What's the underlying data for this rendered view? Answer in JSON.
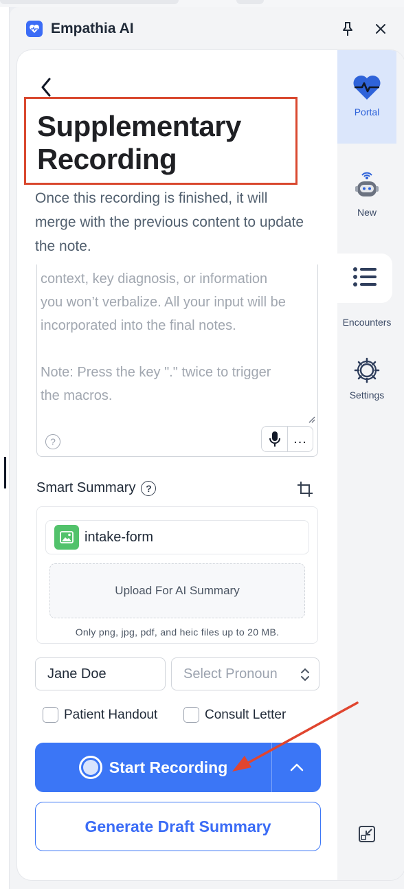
{
  "app": {
    "title": "Empathia AI"
  },
  "page": {
    "title_line1": "Supplementary",
    "title_line2": "Recording",
    "subtitle": "Once this recording is finished, it will merge with the previous content to update the note."
  },
  "notes": {
    "text": "context, key diagnosis, or information\nyou won’t verbalize. All your input will be\nincorporated into the final notes.\n\nNote: Press the key \".\" twice to trigger\nthe macros.",
    "more_label": "..."
  },
  "smart_summary": {
    "label": "Smart Summary",
    "file_name": "intake-form",
    "upload_label": "Upload For AI Summary",
    "hint": "Only png, jpg, pdf, and heic files up to 20 MB."
  },
  "patient": {
    "name_value": "Jane Doe",
    "pronoun_placeholder": "Select Pronoun"
  },
  "options": {
    "patient_handout": "Patient Handout",
    "consult_letter": "Consult Letter"
  },
  "actions": {
    "start_recording": "Start Recording",
    "generate_draft": "Generate Draft Summary"
  },
  "sidebar": {
    "items": [
      {
        "label": "Portal",
        "icon": "heart-pulse-icon",
        "active": true
      },
      {
        "label": "New",
        "icon": "robot-icon",
        "active": false
      },
      {
        "label": "Encounters",
        "icon": "list-icon",
        "active": false
      },
      {
        "label": "Settings",
        "icon": "gear-icon",
        "active": false
      }
    ]
  },
  "colors": {
    "accent": "#3b76f6",
    "highlight_box": "#d9482f",
    "annotation_arrow": "#e0452f",
    "file_icon": "#52c26b"
  }
}
